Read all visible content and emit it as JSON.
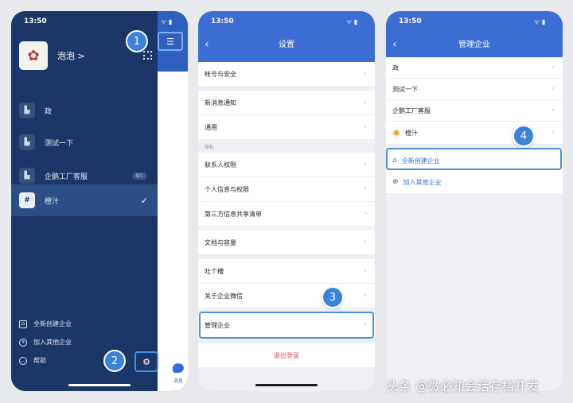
{
  "status_time": "13:50",
  "phone1": {
    "profile_name": "泡泡 >",
    "avatar_icon": "flower-icon",
    "orgs": [
      {
        "label": "政",
        "icon": "building-icon"
      },
      {
        "label": "测试一下",
        "icon": "building-icon"
      },
      {
        "label": "企鹅工厂客服",
        "icon": "building-icon",
        "badge": "9/1"
      },
      {
        "label": "橙汁",
        "icon": "hash-icon",
        "icon_glyph": "#",
        "active": true
      }
    ],
    "footer": [
      {
        "label": "全新创建企业",
        "icon": "home-icon"
      },
      {
        "label": "加入其他企业",
        "icon": "plus-circle-icon"
      },
      {
        "label": "帮助",
        "icon": "help-icon"
      }
    ],
    "messages_tab": "消息",
    "steps": [
      "1",
      "2"
    ]
  },
  "phone2": {
    "title": "设置",
    "rows": [
      {
        "label": "帐号与安全"
      },
      {
        "label": "新消息通知"
      },
      {
        "label": "通用"
      },
      {
        "label": "联系人权限"
      },
      {
        "label": "个人信息与权限"
      },
      {
        "label": "第三方信息共享清单"
      },
      {
        "label": "文档与容量"
      },
      {
        "label": "吐个槽"
      },
      {
        "label": "关于企业微信"
      },
      {
        "label": "管理企业"
      }
    ],
    "section_privacy": "隐私",
    "logout": "退出登录",
    "step": "3"
  },
  "phone3": {
    "title": "管理企业",
    "orgs": [
      {
        "label": "政"
      },
      {
        "label": "测试一下"
      },
      {
        "label": "企鹅工厂客服"
      },
      {
        "label": "橙汁"
      }
    ],
    "create": "全新创建企业",
    "join": "加入其他企业",
    "step": "4"
  },
  "watermark": "头条 @微必知会话存档开发",
  "colors": {
    "navy": "#1b3768",
    "accent": "#3b6dd3",
    "highlight": "#4a90e2",
    "logout": "#d9534f"
  }
}
